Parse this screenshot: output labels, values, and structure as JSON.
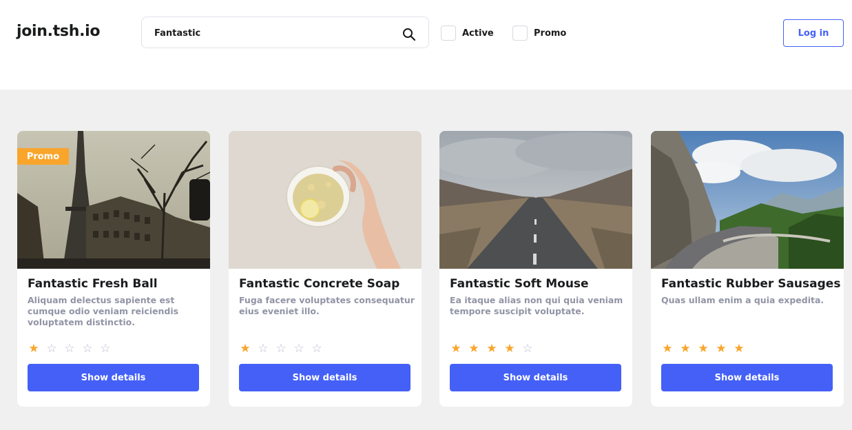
{
  "header": {
    "logo": "join.tsh.io",
    "search": {
      "value": "Fantastic",
      "icon": "search-icon"
    },
    "filters": [
      {
        "label": "Active",
        "checked": false
      },
      {
        "label": "Promo",
        "checked": false
      }
    ],
    "login_label": "Log in"
  },
  "colors": {
    "accent": "#4460f7",
    "promo": "#f9a52b",
    "star_on": "#f9a52b",
    "background": "#f0f0f0"
  },
  "products": [
    {
      "title": "Fantastic Fresh Ball",
      "description": "Aliquam delectus sapiente est cumque odio veniam reiciendis voluptatem distinctio.",
      "promo": true,
      "promo_label": "Promo",
      "rating": 1,
      "image": "eiffel-tower-photo",
      "button": "Show details"
    },
    {
      "title": "Fantastic Concrete Soap",
      "description": "Fuga facere voluptates consequatur eius eveniet illo.",
      "promo": false,
      "rating": 1,
      "image": "lemon-tea-cup-photo",
      "button": "Show details"
    },
    {
      "title": "Fantastic Soft Mouse",
      "description": "Ea itaque alias non qui quia veniam tempore suscipit voluptate.",
      "promo": false,
      "rating": 4,
      "image": "empty-road-photo",
      "button": "Show details"
    },
    {
      "title": "Fantastic Rubber Sausages",
      "description": "Quas ullam enim a quia expedita.",
      "promo": false,
      "rating": 5,
      "image": "mountain-road-photo",
      "button": "Show details"
    }
  ]
}
